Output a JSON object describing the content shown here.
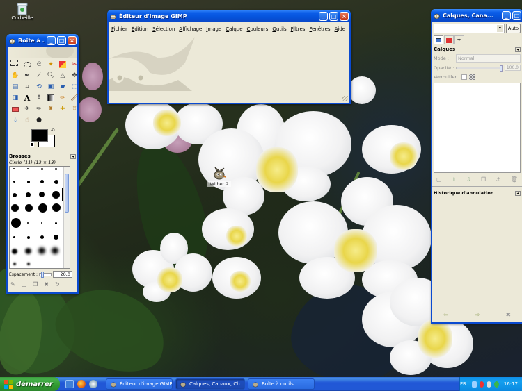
{
  "desktop": {
    "recycle_bin_label": "Corbeille",
    "desktop_icon_label": "Wilber 2"
  },
  "image_window": {
    "title": "Éditeur d'image GIMP",
    "menu": [
      "Fichier",
      "Édition",
      "Sélection",
      "Affichage",
      "Image",
      "Calque",
      "Couleurs",
      "Outils",
      "Filtres",
      "Fenêtres",
      "Aide"
    ]
  },
  "toolbox": {
    "title": "Boîte à ...",
    "brushes_header": "Brosses",
    "brush_name": "Circle (11) (13 × 13)",
    "spacing_label": "Espacement :",
    "spacing_value": "20,0"
  },
  "layers_dialog": {
    "title": "Calques, Cana...",
    "auto_button": "Auto",
    "layers_header": "Calques",
    "mode_label": "Mode :",
    "mode_value": "Normal",
    "opacity_label": "Opacité :",
    "opacity_value": "100,0",
    "lock_label": "Verrouiller :",
    "undo_header": "Historique d'annulation"
  },
  "taskbar": {
    "start_label": "démarrer",
    "tasks": [
      "Éditeur d'image GIMP",
      "Calques, Canaux, Ch...",
      "Boîte à outils"
    ],
    "language": "FR",
    "clock": "16:17"
  },
  "colors": {
    "title_blue": "#0553db",
    "start_green": "#309a30",
    "window_bg": "#ece9d8"
  }
}
